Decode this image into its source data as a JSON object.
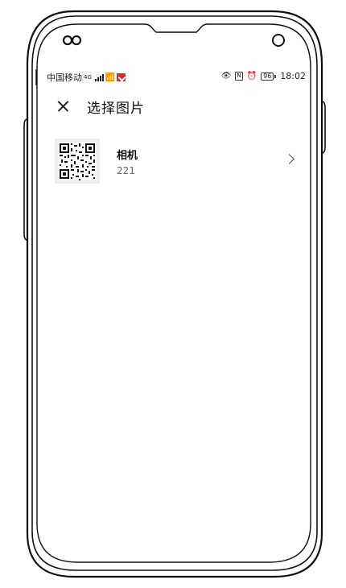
{
  "status_bar": {
    "carrier": "中国移动",
    "signal_tag": "4G",
    "time": "18:02",
    "battery": "96"
  },
  "header": {
    "title": "选择图片"
  },
  "albums": [
    {
      "name": "相机",
      "count": "221"
    }
  ],
  "icons": {
    "close": "close-icon",
    "chevron": "chevron-right-icon",
    "thumbnail": "qr-code-thumbnail"
  }
}
